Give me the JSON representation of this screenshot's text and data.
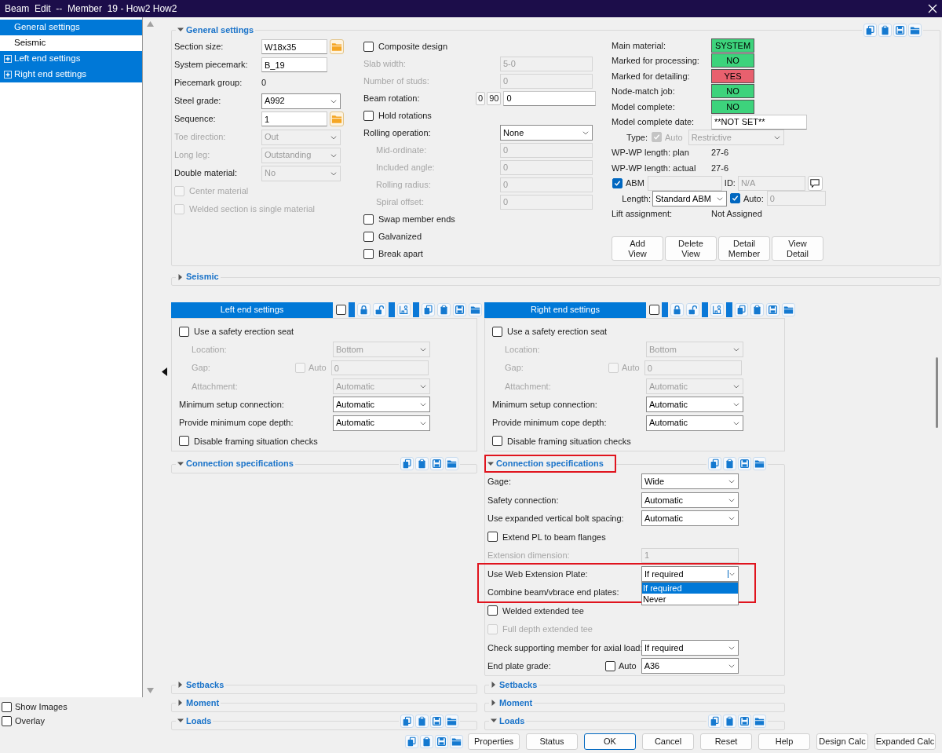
{
  "window": {
    "title": "Beam  Edit  --  Member  19 - How2 How2"
  },
  "tree": [
    {
      "label": "General settings",
      "selected": true,
      "expandable": false
    },
    {
      "label": "Seismic",
      "selected": false,
      "expandable": false
    },
    {
      "label": "Left end settings",
      "selected": true,
      "expandable": true
    },
    {
      "label": "Right end settings",
      "selected": true,
      "expandable": true
    }
  ],
  "view_options": [
    {
      "label": "Show Images",
      "checked": false
    },
    {
      "label": "Overlay",
      "checked": false
    }
  ],
  "general_settings": {
    "title": "General settings",
    "expanded": true,
    "column_1": [
      {
        "kind": "text",
        "label": "Section size:",
        "value": "W18x35",
        "browse": true
      },
      {
        "kind": "text",
        "label": "System piecemark:",
        "value": "B_19"
      },
      {
        "kind": "static",
        "label": "Piecemark group:",
        "value": "0"
      },
      {
        "kind": "select",
        "label": "Steel grade:",
        "value": "A992"
      },
      {
        "kind": "text",
        "label": "Sequence:",
        "value": "1",
        "browse": true
      },
      {
        "kind": "select",
        "label": "Toe direction:",
        "value": "Out",
        "disabled": true,
        "label_disabled": true
      },
      {
        "kind": "select",
        "label": "Long leg:",
        "value": "Outstanding",
        "disabled": true,
        "label_disabled": true
      },
      {
        "kind": "select",
        "label": "Double material:",
        "value": "No",
        "disabled": true
      },
      {
        "kind": "check",
        "label": "Center material",
        "checked": false,
        "disabled": true
      },
      {
        "kind": "check",
        "label": "Welded section is single material",
        "checked": false,
        "disabled": true
      }
    ],
    "column_2": [
      {
        "kind": "check",
        "label": "Composite design",
        "checked": false
      },
      {
        "kind": "text",
        "label": "Slab width:",
        "value": "5-0",
        "disabled": true,
        "label_disabled": true
      },
      {
        "kind": "text",
        "label": "Number of studs:",
        "value": "0",
        "disabled": true,
        "label_disabled": true
      },
      {
        "kind": "rotation",
        "label": "Beam rotation:",
        "presets": [
          "0",
          "90"
        ],
        "value": "0"
      },
      {
        "kind": "check",
        "label": "Hold rotations",
        "checked": false
      },
      {
        "kind": "select",
        "label": "Rolling operation:",
        "value": "None"
      },
      {
        "kind": "text",
        "label": "Mid-ordinate:",
        "value": "0",
        "disabled": true,
        "label_disabled": true,
        "indent": true
      },
      {
        "kind": "text",
        "label": "Included angle:",
        "value": "0",
        "disabled": true,
        "label_disabled": true,
        "indent": true
      },
      {
        "kind": "text",
        "label": "Rolling radius:",
        "value": "0",
        "disabled": true,
        "label_disabled": true,
        "indent": true
      },
      {
        "kind": "text",
        "label": "Spiral offset:",
        "value": "0",
        "disabled": true,
        "label_disabled": true,
        "indent": true
      },
      {
        "kind": "check",
        "label": "Swap member ends",
        "checked": false
      },
      {
        "kind": "check",
        "label": "Galvanized",
        "checked": false
      },
      {
        "kind": "check",
        "label": "Break apart",
        "checked": false
      }
    ],
    "column_3": [
      {
        "kind": "badge",
        "label": "Main material:",
        "value": "SYSTEM",
        "color": "#3dd37c"
      },
      {
        "kind": "badge",
        "label": "Marked for processing:",
        "value": "NO",
        "color": "#3dd37c"
      },
      {
        "kind": "badge",
        "label": "Marked for detailing:",
        "value": "YES",
        "color": "#e8606e"
      },
      {
        "kind": "badge",
        "label": "Node-match job:",
        "value": "NO",
        "color": "#3dd37c"
      },
      {
        "kind": "badge",
        "label": "Model complete:",
        "value": "NO",
        "color": "#3dd37c"
      },
      {
        "kind": "text",
        "label": "Model complete date:",
        "value": "**NOT SET**"
      },
      {
        "kind": "type",
        "label": "Type:",
        "auto_label": "Auto",
        "auto_checked": true,
        "value": "Restrictive",
        "disabled": true
      },
      {
        "kind": "static",
        "label": "WP-WP length: plan",
        "value": "27-6"
      },
      {
        "kind": "static",
        "label": "WP-WP length: actual",
        "value": "27-6"
      },
      {
        "kind": "abm",
        "label": "ABM",
        "checked": true,
        "id_label": "ID:",
        "id_value": "N/A",
        "disabled": true
      },
      {
        "kind": "length",
        "label": "Length:",
        "value": "Standard ABM",
        "auto_label": "Auto:",
        "auto_checked": true,
        "auto_value": "0"
      },
      {
        "kind": "static",
        "label": "Lift assignment:",
        "value": "Not Assigned"
      }
    ],
    "buttons": [
      [
        "Add",
        "View"
      ],
      [
        "Delete",
        "View"
      ],
      [
        "Detail",
        "Member"
      ],
      [
        "View",
        "Detail"
      ]
    ]
  },
  "seismic": {
    "title": "Seismic",
    "expanded": false
  },
  "end_settings": [
    {
      "title": "Left end settings",
      "checked": false,
      "rows": [
        {
          "kind": "check",
          "label": "Use a safety erection seat",
          "checked": false
        },
        {
          "kind": "select",
          "label": "Location:",
          "value": "Bottom",
          "disabled": true,
          "label_disabled": true,
          "indent": true
        },
        {
          "kind": "auto_text",
          "label": "Gap:",
          "auto_label": "Auto",
          "auto_checked": false,
          "value": "0",
          "disabled": true,
          "label_disabled": true,
          "indent": true
        },
        {
          "kind": "select",
          "label": "Attachment:",
          "value": "Automatic",
          "disabled": true,
          "label_disabled": true,
          "indent": true
        },
        {
          "kind": "select",
          "label": "Minimum setup connection:",
          "value": "Automatic"
        },
        {
          "kind": "select",
          "label": "Provide minimum cope depth:",
          "value": "Automatic"
        },
        {
          "kind": "check",
          "label": "Disable framing situation checks",
          "checked": false
        }
      ],
      "connection_specifications": {
        "title": "Connection specifications",
        "expanded": true
      }
    },
    {
      "title": "Right end settings",
      "checked": false,
      "rows": [
        {
          "kind": "check",
          "label": "Use a safety erection seat",
          "checked": false
        },
        {
          "kind": "select",
          "label": "Location:",
          "value": "Bottom",
          "disabled": true,
          "label_disabled": true,
          "indent": true
        },
        {
          "kind": "auto_text",
          "label": "Gap:",
          "auto_label": "Auto",
          "auto_checked": false,
          "value": "0",
          "disabled": true,
          "label_disabled": true,
          "indent": true
        },
        {
          "kind": "select",
          "label": "Attachment:",
          "value": "Automatic",
          "disabled": true,
          "label_disabled": true,
          "indent": true
        },
        {
          "kind": "select",
          "label": "Minimum setup connection:",
          "value": "Automatic"
        },
        {
          "kind": "select",
          "label": "Provide minimum cope depth:",
          "value": "Automatic"
        },
        {
          "kind": "check",
          "label": "Disable framing situation checks",
          "checked": false
        }
      ],
      "connection_specifications": {
        "title": "Connection specifications",
        "expanded": true,
        "highlighted": true,
        "rows": [
          {
            "kind": "select",
            "label": "Gage:",
            "value": "Wide"
          },
          {
            "kind": "select",
            "label": "Safety connection:",
            "value": "Automatic"
          },
          {
            "kind": "select",
            "label": "Use expanded vertical bolt spacing:",
            "value": "Automatic"
          },
          {
            "kind": "check",
            "label": "Extend PL to beam flanges",
            "checked": false
          },
          {
            "kind": "text",
            "label": "Extension dimension:",
            "value": "1",
            "disabled": true,
            "label_disabled": true
          },
          {
            "kind": "select",
            "label": "Use Web Extension Plate:",
            "value": "If required",
            "highlighted": true,
            "open": true,
            "options": [
              {
                "label": "If required",
                "selected": true
              },
              {
                "label": "Never",
                "selected": false
              }
            ]
          },
          {
            "kind": "label",
            "label": "Combine beam/vbrace end plates:",
            "highlighted": true
          },
          {
            "kind": "check",
            "label": "Welded extended tee",
            "checked": false
          },
          {
            "kind": "check",
            "label": "Full depth extended tee",
            "checked": false,
            "disabled": true
          },
          {
            "kind": "select",
            "label": "Check supporting member for axial load:",
            "value": "If required"
          },
          {
            "kind": "auto_select",
            "label": "End plate grade:",
            "auto_label": "Auto",
            "auto_checked": false,
            "value": "A36"
          }
        ]
      }
    }
  ],
  "lower_sections": [
    [
      {
        "title": "Setbacks",
        "expanded": false
      },
      {
        "title": "Moment",
        "expanded": false
      },
      {
        "title": "Loads",
        "expanded": true
      }
    ],
    [
      {
        "title": "Setbacks",
        "expanded": false
      },
      {
        "title": "Moment",
        "expanded": false
      },
      {
        "title": "Loads",
        "expanded": true
      }
    ]
  ],
  "dialog_buttons": [
    {
      "label": "Properties",
      "default": false
    },
    {
      "label": "Status",
      "default": false
    },
    {
      "label": "OK",
      "default": true
    },
    {
      "label": "Cancel",
      "default": false
    },
    {
      "label": "Reset",
      "default": false
    },
    {
      "label": "Help",
      "default": false
    },
    {
      "label": "Design Calc",
      "default": false
    },
    {
      "label": "Expanded Calc",
      "default": false
    }
  ]
}
